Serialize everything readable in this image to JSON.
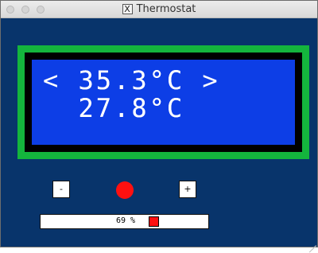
{
  "window": {
    "title": "Thermostat",
    "app_icon": "x11-icon",
    "background_color": "#08346b"
  },
  "lcd": {
    "frame_color": "#14b53d",
    "screen_color": "#0d3ee6",
    "line1": {
      "left_arrow": "<",
      "value": "35.3°C",
      "right_arrow": ">"
    },
    "line2": {
      "value": "27.8°C"
    }
  },
  "controls": {
    "decrease_label": "-",
    "increase_label": "+",
    "heating_indicator_color": "#ff1010",
    "heating_indicator_icon": "red-circle-icon"
  },
  "status_bar": {
    "text": "69 %",
    "marker_color": "#ff1010",
    "marker_icon": "red-square-icon"
  }
}
